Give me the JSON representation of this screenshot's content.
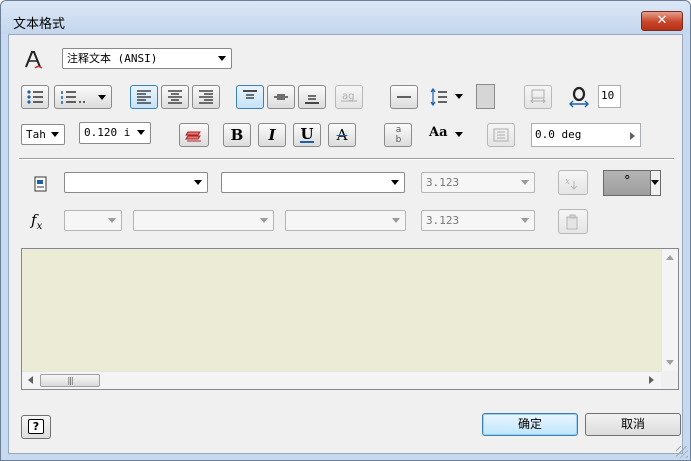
{
  "window": {
    "title": "文本格式",
    "close_label": "✕"
  },
  "toolbar1": {
    "style_select": "注释文本 (ANSI)",
    "spacing_value": "10"
  },
  "toolbar2": {
    "font_select": "Tah",
    "size_select": "0.120 i",
    "rotation_value": "0.0 deg",
    "bold_label": "B",
    "italic_label": "I",
    "underline_label": "U",
    "strike_label": "A",
    "stack_label": "ab",
    "case_label": "Aa"
  },
  "params_row": {
    "component_select": "",
    "source_select": "",
    "parameter_select": "",
    "precision_select": "3.123",
    "symbol_value": "°"
  },
  "fx_row": {
    "type_select": "",
    "property_select": "",
    "property2_select": "",
    "precision_select": "3.123"
  },
  "text_area": {
    "content": ""
  },
  "footer": {
    "ok_label": "确定",
    "cancel_label": "取消",
    "help_label": "?"
  },
  "colors": {
    "text_area_bg": "#ecebd6",
    "accent": "#3c7fb1",
    "close": "#c8442a"
  }
}
